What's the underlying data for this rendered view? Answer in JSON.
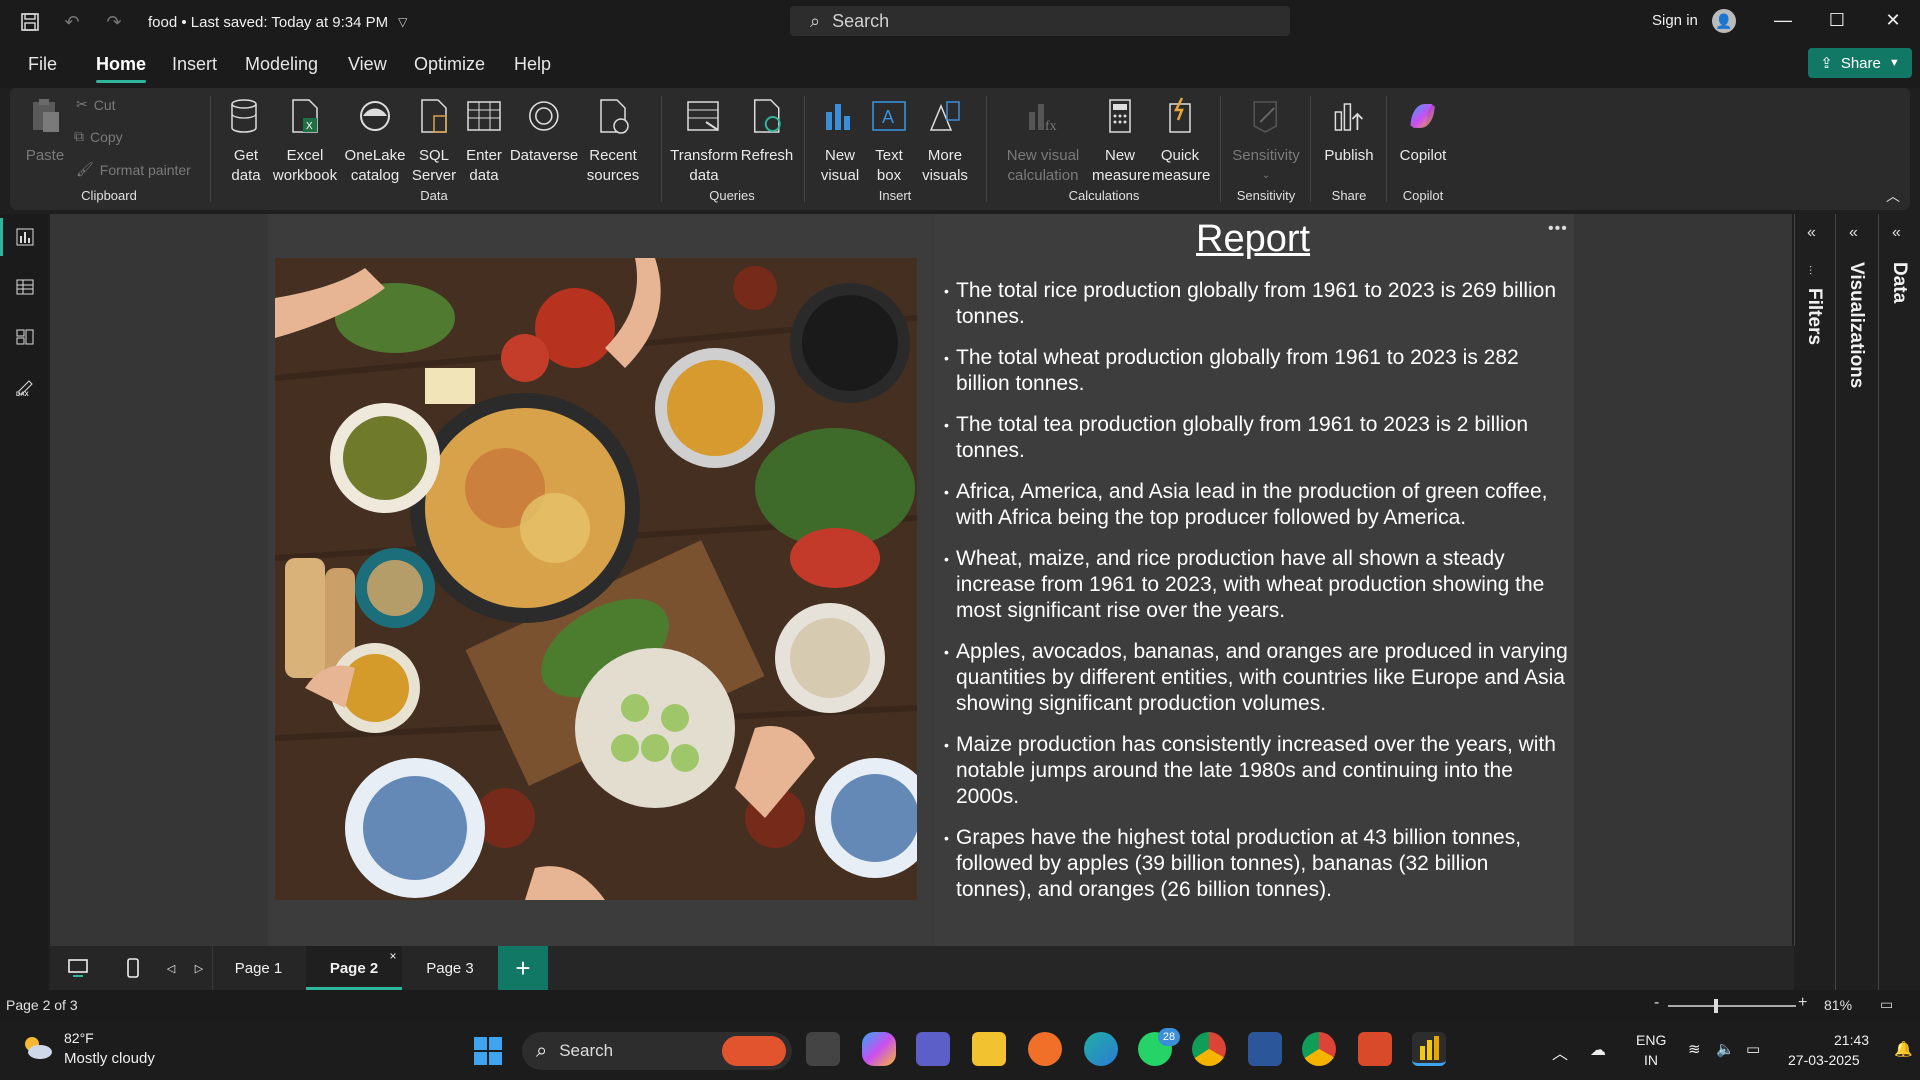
{
  "titlebar": {
    "file_name": "food",
    "saved_status": "Last saved: Today at 9:34 PM",
    "search_placeholder": "Search",
    "sign_in": "Sign in"
  },
  "menu": {
    "items": [
      "File",
      "Home",
      "Insert",
      "Modeling",
      "View",
      "Optimize",
      "Help"
    ],
    "active": "Home",
    "share_label": "Share"
  },
  "ribbon": {
    "clipboard": {
      "paste": "Paste",
      "cut": "Cut",
      "copy": "Copy",
      "format_painter": "Format painter",
      "label": "Clipboard"
    },
    "data": {
      "get_data": "Get data",
      "excel": "Excel workbook",
      "onelake": "OneLake catalog",
      "sql": "SQL Server",
      "enter": "Enter data",
      "dataverse": "Dataverse",
      "recent": "Recent sources",
      "label": "Data"
    },
    "queries": {
      "transform": "Transform data",
      "refresh": "Refresh",
      "label": "Queries"
    },
    "insert": {
      "new_visual": "New visual",
      "text_box": "Text box",
      "more_visuals": "More visuals",
      "label": "Insert"
    },
    "calculations": {
      "new_visual_calc": "New visual calculation",
      "new_measure": "New measure",
      "quick_measure": "Quick measure",
      "label": "Calculations"
    },
    "sensitivity": {
      "btn": "Sensitivity",
      "label": "Sensitivity"
    },
    "share": {
      "publish": "Publish",
      "label": "Share"
    },
    "copilot": {
      "btn": "Copilot",
      "label": "Copilot"
    }
  },
  "report": {
    "title": "Report",
    "bullets": [
      "The total rice production globally from 1961 to 2023 is 269 billion tonnes.",
      "The total wheat production globally from 1961 to 2023 is 282 billion tonnes.",
      "The total tea production globally from 1961 to 2023 is 2 billion tonnes.",
      "Africa, America, and Asia lead in the production of green coffee, with Africa being the top producer followed by America.",
      "Wheat, maize, and rice production have all shown a steady increase from 1961 to 2023, with wheat production showing the most significant rise over the years.",
      "Apples, avocados, bananas, and oranges are produced in varying quantities by different entities, with countries like Europe and Asia showing significant production volumes.",
      "Maize production has consistently increased over the years, with notable jumps around the late 1980s and continuing into the 2000s.",
      "Grapes have the highest total production at 43 billion tonnes, followed by apples (39 billion tonnes), bananas (32 billion tonnes), and oranges (26 billion tonnes)."
    ]
  },
  "panes": {
    "filters": "Filters",
    "visualizations": "Visualizations",
    "data": "Data"
  },
  "pages": {
    "tabs": [
      "Page 1",
      "Page 2",
      "Page 3"
    ],
    "active": "Page 2",
    "add": "+"
  },
  "status": {
    "page_indicator": "Page 2 of 3",
    "zoom": "81%",
    "zoom_minus": "-",
    "zoom_plus": "+"
  },
  "taskbar": {
    "weather_temp": "82°F",
    "weather_desc": "Mostly cloudy",
    "search": "Search",
    "lang": "ENG",
    "region": "IN",
    "time": "21:43",
    "date": "27-03-2025",
    "whatsapp_badge": "28"
  },
  "colors": {
    "accent": "#117865",
    "highlight": "#2fb59b"
  }
}
